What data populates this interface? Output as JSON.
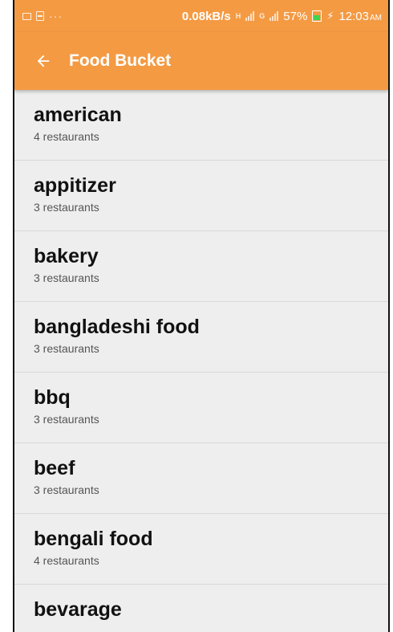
{
  "status_bar": {
    "left_dots": "···",
    "net_speed": "0.08kB/s",
    "signal_prefix_1": "H",
    "signal_prefix_2": "G",
    "battery_pct": "57%",
    "bolt": "⚡",
    "time": "12:03",
    "ampm": "AM"
  },
  "app_bar": {
    "title": "Food Bucket"
  },
  "categories": [
    {
      "name": "american",
      "count": "4 restaurants"
    },
    {
      "name": "appitizer",
      "count": "3 restaurants"
    },
    {
      "name": "bakery",
      "count": "3 restaurants"
    },
    {
      "name": "bangladeshi food",
      "count": "3 restaurants"
    },
    {
      "name": "bbq",
      "count": "3 restaurants"
    },
    {
      "name": "beef",
      "count": "3 restaurants"
    },
    {
      "name": "bengali food",
      "count": "4 restaurants"
    },
    {
      "name": "bevarage",
      "count": ""
    }
  ],
  "colors": {
    "primary": "#f49a43",
    "list_bg": "#eeeeee",
    "divider": "#d9d9d9"
  }
}
